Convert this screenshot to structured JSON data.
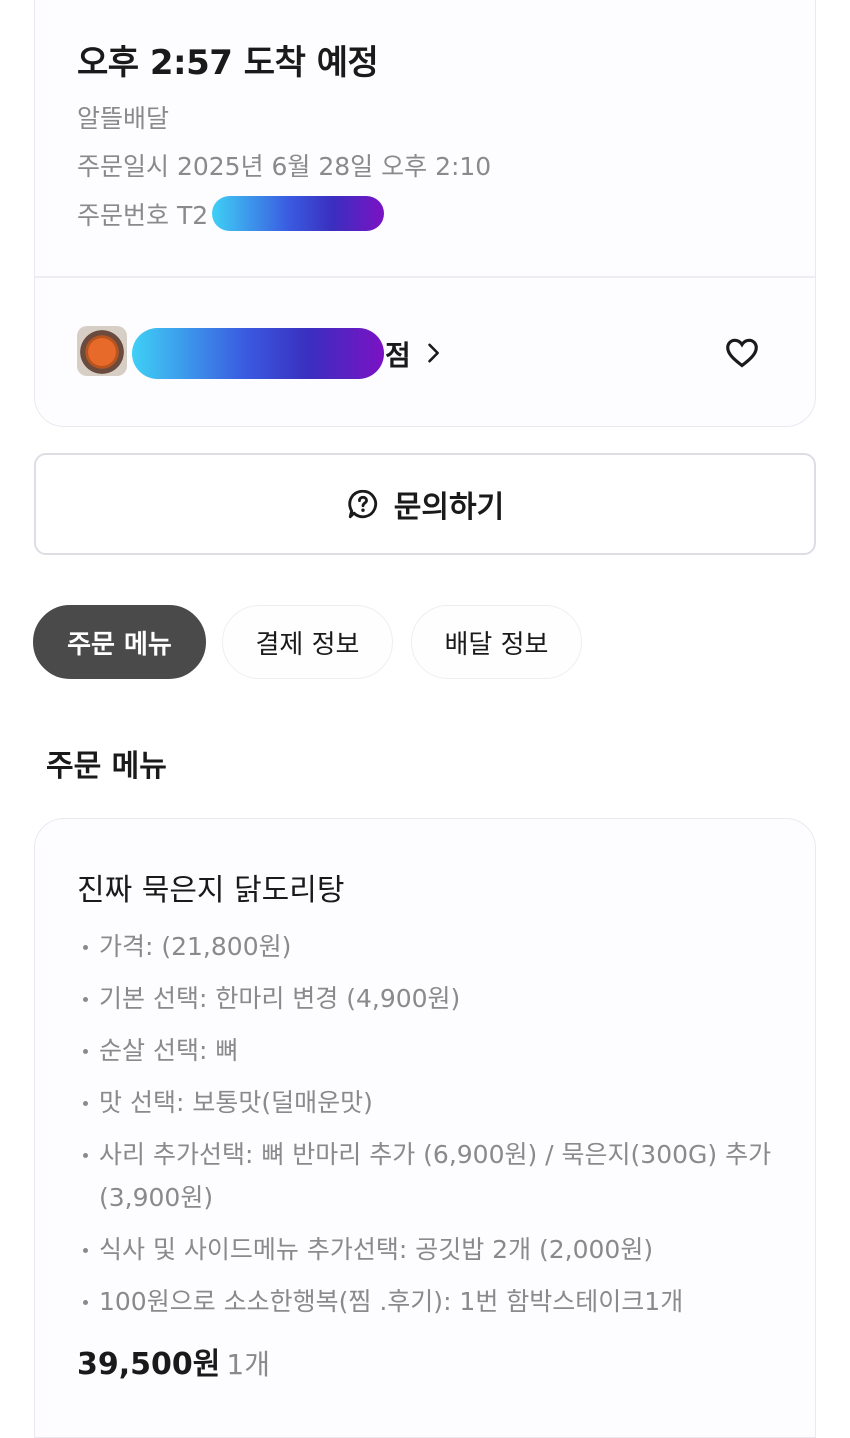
{
  "order": {
    "arrival": "오후 2:57 도착 예정",
    "delivery_type": "알뜰배달",
    "ordered_at": "주문일시 2025년 6월 28일 오후 2:10",
    "order_no_prefix": "주문번호 T2",
    "store_suffix": "점"
  },
  "inquiry": {
    "label": "문의하기"
  },
  "tabs": [
    {
      "label": "주문 메뉴",
      "active": true
    },
    {
      "label": "결제 정보",
      "active": false
    },
    {
      "label": "배달 정보",
      "active": false
    }
  ],
  "section": {
    "title": "주문 메뉴"
  },
  "menu": {
    "name": "진짜 묵은지 닭도리탕",
    "options": [
      "가격: (21,800원)",
      "기본 선택: 한마리 변경 (4,900원)",
      "순살 선택: 뼈",
      "맛 선택: 보통맛(덜매운맛)",
      "사리 추가선택: 뼈 반마리 추가 (6,900원) / 묵은지(300G) 추가 (3,900원)",
      "식사 및 사이드메뉴 추가선택: 공깃밥 2개 (2,000원)",
      "100원으로 소소한행복(찜 .후기): 1번 함박스테이크1개"
    ],
    "price": "39,500원",
    "quantity": "1개"
  },
  "icons": {
    "store_chevron": "chevron-right-icon",
    "favorite": "heart-icon",
    "inquiry": "question-bubble-icon"
  },
  "colors": {
    "active_tab": "#4a4a4a",
    "muted_text": "#8a8a8a"
  }
}
